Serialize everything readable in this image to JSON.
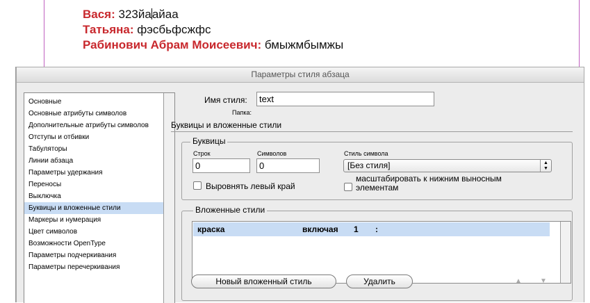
{
  "document": {
    "lines": [
      {
        "name": "Вася:",
        "text_before": " 323йа",
        "text_after": "айаа"
      },
      {
        "name": "Татьяна:",
        "text": " фэсбьфсжфс"
      },
      {
        "name": "Рабинович Абрам Моисеевич:",
        "text": " бмыжмбымжы"
      }
    ]
  },
  "dialog": {
    "title": "Параметры стиля абзаца",
    "categories": [
      "Основные",
      "Основные атрибуты символов",
      "Дополнительные атрибуты символов",
      "Отступы и отбивки",
      "Табуляторы",
      "Линии абзаца",
      "Параметры удержания",
      "Переносы",
      "Выключка",
      "Буквицы и вложенные стили",
      "Маркеры и нумерация",
      "Цвет символов",
      "Возможности OpenType",
      "Параметры подчеркивания",
      "Параметры перечеркивания"
    ],
    "selected_category": "Буквицы и вложенные стили",
    "style_name_label": "Имя стиля:",
    "style_name_value": "text",
    "folder_label": "Папка:",
    "section_title": "Буквицы и вложенные стили",
    "dropcaps": {
      "title": "Буквицы",
      "lines_label": "Строк",
      "lines_value": "0",
      "chars_label": "Символов",
      "chars_value": "0",
      "char_style_label": "Стиль символа",
      "char_style_value": "[Без стиля]",
      "align_left_label": "Выровнять левый край",
      "align_left_checked": false,
      "scale_label_1": "масштабировать к нижним выносным",
      "scale_label_2": "элементам",
      "scale_checked": false
    },
    "nested": {
      "title": "Вложенные стили",
      "rows": [
        {
          "style": "краска",
          "mode": "включая",
          "count": "1",
          "delimiter": ":"
        }
      ],
      "new_button": "Новый вложенный стиль",
      "delete_button": "Удалить",
      "up_icon": "▲",
      "down_icon": "▼"
    }
  }
}
